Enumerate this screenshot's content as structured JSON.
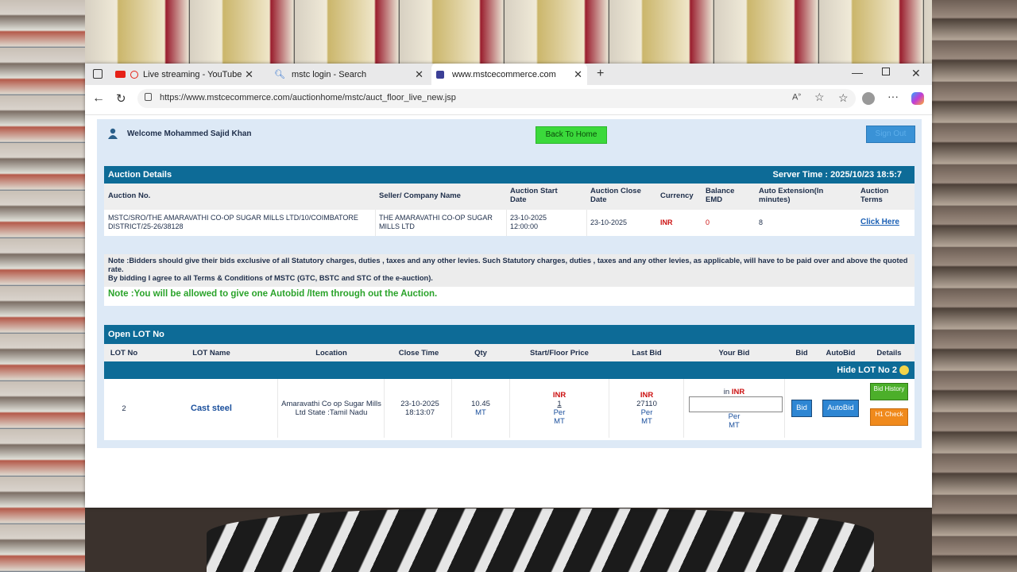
{
  "browser": {
    "tabs": [
      {
        "title": "Live streaming - YouTube Studio",
        "icon": "youtube-icon"
      },
      {
        "title": "mstc login - Search",
        "icon": "search-icon"
      },
      {
        "title": "www.mstcecommerce.com",
        "icon": "site-icon"
      }
    ],
    "url": "https://www.mstcecommerce.com/auctionhome/mstc/auct_floor_live_new.jsp"
  },
  "header": {
    "welcome": "Welcome Mohammed Sajid Khan",
    "back_home": "Back To Home",
    "sign_out": "Sign Out"
  },
  "auction": {
    "title": "Auction Details",
    "server_time": "Server Time : 2025/10/23 18:5:7",
    "columns": [
      "Auction No.",
      "Seller/ Company Name",
      "Auction Start Date",
      "Auction Close Date",
      "Currency",
      "Balance EMD",
      "Auto Extension(In minutes)",
      "Auction Terms"
    ],
    "row": {
      "auction_no": "MSTC/SRO/THE AMARAVATHI CO-OP SUGAR MILLS LTD/10/COIMBATORE DISTRICT/25-26/38128",
      "seller": "THE AMARAVATHI CO-OP SUGAR MILLS LTD",
      "start_date": "23-10-2025 12:00:00",
      "close_date": "23-10-2025",
      "currency": "INR",
      "balance_emd": "0",
      "auto_extension": "8",
      "terms": "Click Here"
    }
  },
  "notes": {
    "statutory": "Note :Bidders should give their bids exclusive of all Statutory charges, duties , taxes and any other levies. Such Statutory charges, duties , taxes and any other levies, as applicable, will have to be paid over and above the quoted rate.",
    "agree": "By bidding I agree to all Terms & Conditions of MSTC (GTC, BSTC and STC of the e-auction).",
    "autobid": "Note :You will be allowed to give one Autobid /Item through out the Auction."
  },
  "lots": {
    "title": "Open LOT No",
    "columns": [
      "LOT No",
      "LOT Name",
      "Location",
      "Close Time",
      "Qty",
      "Start/Floor Price",
      "Last Bid",
      "Your Bid",
      "Bid",
      "AutoBid",
      "Details"
    ],
    "hide_label": "Hide LOT No 2",
    "row": {
      "lot_no": "2",
      "lot_name": "Cast steel",
      "location": "Amaravathi Co op Sugar Mills Ltd State :Tamil Nadu",
      "close_date": "23-10-2025",
      "close_time": "18:13:07",
      "qty": "10.45",
      "qty_unit": "MT",
      "start_currency": "INR",
      "start_price": "1",
      "start_per": "Per",
      "start_unit": "MT",
      "last_currency": "INR",
      "last_bid": "27110",
      "last_per": "Per",
      "last_unit": "MT",
      "your_bid_prefix": "in",
      "your_bid_currency": "INR",
      "your_bid_value": "",
      "your_bid_per": "Per",
      "your_bid_unit": "MT",
      "bid_button": "Bid",
      "autobid_button": "AutoBid",
      "bid_history": "Bid History",
      "h1_check": "H1 Check"
    }
  }
}
